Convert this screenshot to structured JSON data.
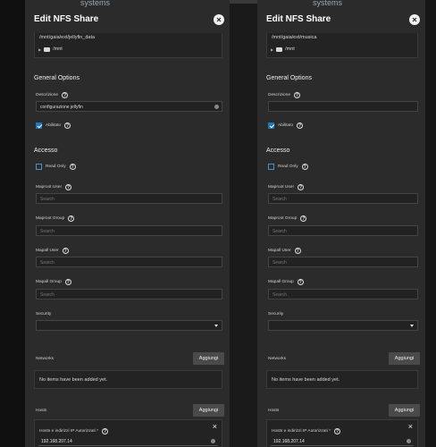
{
  "app": {
    "brand": "systems"
  },
  "panels": [
    {
      "title": "Edit NFS Share",
      "path": "/mnt/gaia/ext/jellyfin_data",
      "tree_item": "/mnt",
      "general_heading": "General Options",
      "descrizione_label": "Descrizione",
      "descrizione_value": "configurazione jellyfin",
      "abilitato_label": "Abilitato",
      "abilitato_checked": true,
      "accesso_heading": "Accesso",
      "read_only_label": "Read Only",
      "read_only_checked": false,
      "maproot_user_label": "Maproot User",
      "maproot_group_label": "Maproot Group",
      "mapall_user_label": "Mapall User",
      "mapall_group_label": "Mapall Group",
      "search_placeholder": "Search",
      "security_label": "Security",
      "networks_label": "Networks",
      "add_label": "Aggiungi",
      "empty_text": "No items have been added yet.",
      "hosts_label": "Hosts",
      "host_field_label": "Hosts e indirizzi IP Autorizzati *",
      "host_value": "192.168.207.14"
    },
    {
      "title": "Edit NFS Share",
      "path": "/mnt/gaia/ext/musica",
      "tree_item": "/mnt",
      "general_heading": "General Options",
      "descrizione_label": "Descrizione",
      "descrizione_value": "",
      "abilitato_label": "Abilitato",
      "abilitato_checked": true,
      "accesso_heading": "Accesso",
      "read_only_label": "Read Only",
      "read_only_checked": false,
      "maproot_user_label": "Maproot User",
      "maproot_group_label": "Maproot Group",
      "mapall_user_label": "Mapall User",
      "mapall_group_label": "Mapall Group",
      "search_placeholder": "Search",
      "security_label": "Security",
      "networks_label": "Networks",
      "add_label": "Aggiungi",
      "empty_text": "No items have been added yet.",
      "hosts_label": "Hosts",
      "host_field_label": "Hosts e indirizzi IP Autorizzati *",
      "host_value": "192.168.207.14"
    }
  ],
  "colors": {
    "accent": "#1f78b4",
    "panel_bg": "#2b2b2b",
    "page_bg": "#0f0f0f"
  },
  "icons": {
    "close": "close-icon",
    "help": "help-icon",
    "folder": "folder-icon"
  }
}
